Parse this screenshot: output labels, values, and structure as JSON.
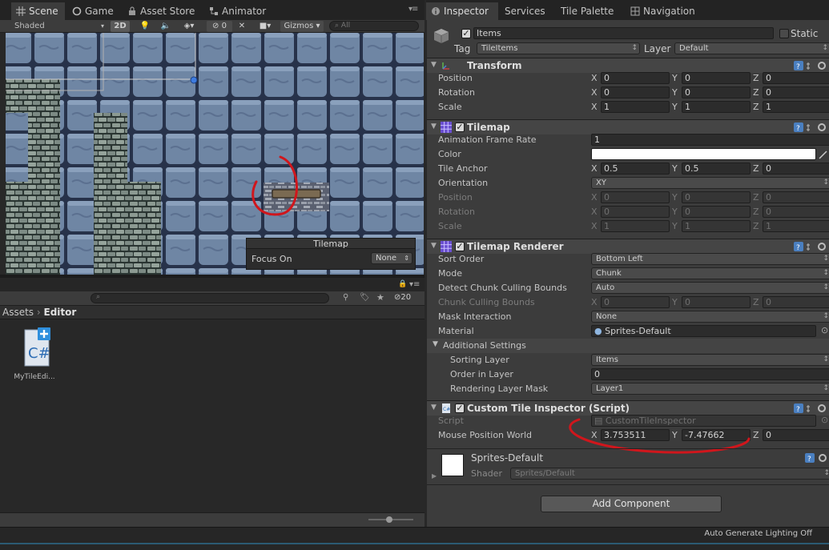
{
  "scene_window": {
    "tabs": [
      {
        "label": "Scene",
        "icon": "grid-icon"
      },
      {
        "label": "Game",
        "icon": "game-pad-icon"
      },
      {
        "label": "Asset Store",
        "icon": "lock-bag-icon"
      },
      {
        "label": "Animator",
        "icon": "animator-icon"
      }
    ],
    "toolbar": {
      "shading_mode": "Shaded",
      "mode_2d": "2D",
      "hidden_count": "0",
      "gizmos": "Gizmos",
      "search_placeholder": "All"
    },
    "tilemap_overlay": {
      "title": "Tilemap",
      "focus_label": "Focus On",
      "focus_value": "None"
    }
  },
  "project_window": {
    "visible_count": "20",
    "breadcrumb": [
      "Assets",
      "Editor"
    ],
    "assets": [
      {
        "name": "MyTileEdi...",
        "icon": "csharp-script-icon",
        "glyph": "C#"
      }
    ]
  },
  "inspector_window": {
    "tabs": [
      {
        "label": "Inspector",
        "icon": "info-icon"
      },
      {
        "label": "Services",
        "icon": ""
      },
      {
        "label": "Tile Palette",
        "icon": ""
      },
      {
        "label": "Navigation",
        "icon": "navigation-icon"
      }
    ],
    "object": {
      "name": "Items",
      "static_label": "Static",
      "tag_label": "Tag",
      "tag_value": "TileItems",
      "layer_label": "Layer",
      "layer_value": "Default"
    },
    "transform": {
      "title": "Transform",
      "position": {
        "label": "Position",
        "x": "0",
        "y": "0",
        "z": "0"
      },
      "rotation": {
        "label": "Rotation",
        "x": "0",
        "y": "0",
        "z": "0"
      },
      "scale": {
        "label": "Scale",
        "x": "1",
        "y": "1",
        "z": "1"
      }
    },
    "tilemap": {
      "title": "Tilemap",
      "frame_rate_label": "Animation Frame Rate",
      "frame_rate": "1",
      "color_label": "Color",
      "color": "#ffffff",
      "anchor": {
        "label": "Tile Anchor",
        "x": "0.5",
        "y": "0.5",
        "z": "0"
      },
      "orientation_label": "Orientation",
      "orientation": "XY",
      "position": {
        "label": "Position",
        "x": "0",
        "y": "0",
        "z": "0"
      },
      "rotation": {
        "label": "Rotation",
        "x": "0",
        "y": "0",
        "z": "0"
      },
      "scale": {
        "label": "Scale",
        "x": "1",
        "y": "1",
        "z": "1"
      }
    },
    "renderer": {
      "title": "Tilemap Renderer",
      "sort_order_label": "Sort Order",
      "sort_order": "Bottom Left",
      "mode_label": "Mode",
      "mode": "Chunk",
      "detect_label": "Detect Chunk Culling Bounds",
      "detect": "Auto",
      "chunk_bounds": {
        "label": "Chunk Culling Bounds",
        "x": "0",
        "y": "0",
        "z": "0"
      },
      "mask_label": "Mask Interaction",
      "mask": "None",
      "material_label": "Material",
      "material": "Sprites-Default",
      "additional_label": "Additional Settings",
      "sorting_layer_label": "Sorting Layer",
      "sorting_layer": "Items",
      "order_label": "Order in Layer",
      "order": "0",
      "rendering_mask_label": "Rendering Layer Mask",
      "rendering_mask": "Layer1"
    },
    "custom_script": {
      "title": "Custom Tile Inspector (Script)",
      "script_label": "Script",
      "script": "CustomTileInspector",
      "mouse_label": "Mouse Position World",
      "x": "3.753511",
      "y": "-7.47662",
      "z": "0"
    },
    "material_preview": {
      "name": "Sprites-Default",
      "shader_label": "Shader",
      "shader": "Sprites/Default"
    },
    "add_component": "Add Component"
  },
  "status_bar": {
    "text": "Auto Generate Lighting Off"
  },
  "colors": {
    "annotation": "#d0161c",
    "accent": "#2b5a73"
  }
}
